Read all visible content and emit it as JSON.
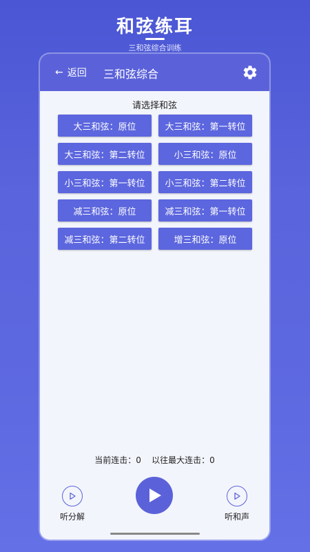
{
  "promo": {
    "title": "和弦练耳",
    "subtitle": "三和弦综合训练"
  },
  "appbar": {
    "back_arrow": "←",
    "back_label": "返回",
    "title": "三和弦综合",
    "settings_icon": "gear-icon"
  },
  "section": {
    "title": "请选择和弦"
  },
  "chords": [
    "大三和弦：原位",
    "大三和弦：第一转位",
    "大三和弦：第二转位",
    "小三和弦：原位",
    "小三和弦：第一转位",
    "小三和弦：第二转位",
    "减三和弦：原位",
    "减三和弦：第一转位",
    "减三和弦：第二转位",
    "增三和弦：原位"
  ],
  "streak": {
    "current_label": "当前连击：",
    "current_value": "0",
    "best_label": "以往最大连击：",
    "best_value": "0"
  },
  "controls": {
    "left_label": "听分解",
    "right_label": "听和声",
    "play_icon": "play-icon"
  },
  "colors": {
    "accent": "#5b62d9",
    "button": "#5c66de",
    "panel": "#f3f5fc"
  }
}
